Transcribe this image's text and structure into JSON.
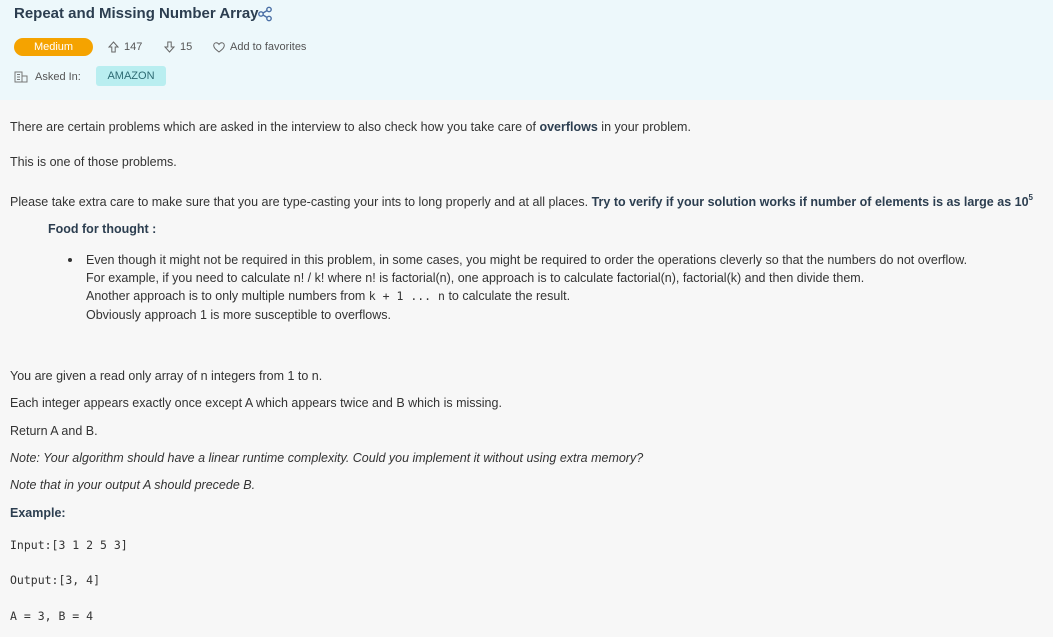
{
  "problem": {
    "title": "Repeat and Missing Number Array",
    "difficulty": "Medium",
    "upvotes": "147",
    "downvotes": "15",
    "favorite_label": "Add to favorites",
    "asked_in_label": "Asked In:",
    "company": "AMAZON"
  },
  "description": {
    "p1_pre": "There are certain problems which are asked in the interview to also check how you take care of",
    "p1_bold": "overflows",
    "p1_post": "in your problem.",
    "p2": "This is one of those problems.",
    "p3_pre": "Please take extra care to make sure that you are type-casting your ints to long properly and at all places.",
    "p3_bold": "Try to verify if your solution works if number of elements is as large as 10",
    "p3_sup": "5",
    "food_label": "Food for thought :",
    "bullet_l1": "Even though it might not be required in this problem, in some cases, you might be required to order the operations cleverly so that the numbers do not overflow.",
    "bullet_l2": "For example, if you need to calculate n! / k! where n! is factorial(n), one approach is to calculate factorial(n), factorial(k) and then divide them.",
    "bullet_l3_pre": "Another approach is to only multiple numbers from",
    "bullet_l3_code": "k + 1 ... n",
    "bullet_l3_post": "to calculate the result.",
    "bullet_l4": "Obviously approach 1 is more susceptible to overflows.",
    "p4": "You are given a read only array of n integers from 1 to n.",
    "p5": "Each integer appears exactly once except A which appears twice and B which is missing.",
    "p6": "Return A and B.",
    "p7": "Note: Your algorithm should have a linear runtime complexity. Could you implement it without using extra memory?",
    "p8": "Note that in your output A should precede B.",
    "example_label": "Example:",
    "input_line": "Input:[3 1 2 5 3]",
    "output_line": "Output:[3, 4]",
    "result_line": "A = 3, B = 4"
  },
  "colors": {
    "accent": "#f5a300",
    "header_bg": "#edf8fb",
    "tag_bg": "#b9eef0"
  }
}
